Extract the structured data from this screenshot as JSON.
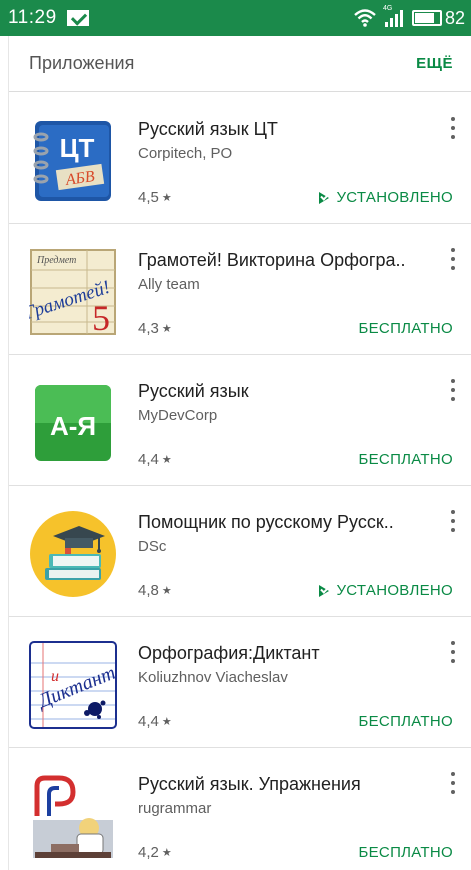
{
  "status_bar": {
    "time": "11:29",
    "battery_text": "82",
    "signal_label": "4G"
  },
  "section": {
    "title": "Приложения",
    "more_label": "ЕЩЁ"
  },
  "apps": [
    {
      "name": "Русский язык ЦТ",
      "developer": "Corpitech, PO",
      "rating": "4,5",
      "status": "УСТАНОВЛЕНО",
      "installed": true,
      "icon": "ct-abv-icon",
      "icon_text_1": "ЦТ",
      "icon_text_2": "АБВ"
    },
    {
      "name": "Грамотей! Викторина Орфогра..",
      "developer": "Ally team",
      "rating": "4,3",
      "status": "БЕСПЛАТНО",
      "installed": false,
      "icon": "gramotey-icon",
      "icon_text_1": "Предмет",
      "icon_text_2": "Грамотей!",
      "icon_text_3": "5"
    },
    {
      "name": "Русский язык",
      "developer": "MyDevCorp",
      "rating": "4,4",
      "status": "БЕСПЛАТНО",
      "installed": false,
      "icon": "a-ya-icon",
      "icon_text_1": "А-Я"
    },
    {
      "name": "Помощник по русскому Русск..",
      "developer": "DSc",
      "rating": "4,8",
      "status": "УСТАНОВЛЕНО",
      "installed": true,
      "icon": "books-graduation-icon"
    },
    {
      "name": "Орфография:Диктант",
      "developer": "Koliuzhnov Viacheslav",
      "rating": "4,4",
      "status": "БЕСПЛАТНО",
      "installed": false,
      "icon": "diktant-icon",
      "icon_text_1": "Диктант",
      "icon_text_2": "и"
    },
    {
      "name": "Русский язык. Упражнения",
      "developer": "rugrammar",
      "rating": "4,2",
      "status": "БЕСПЛАТНО",
      "installed": false,
      "icon": "rugrammar-icon"
    }
  ],
  "colors": {
    "status_bar": "#1b8a4b",
    "accent": "#0a8a45"
  }
}
